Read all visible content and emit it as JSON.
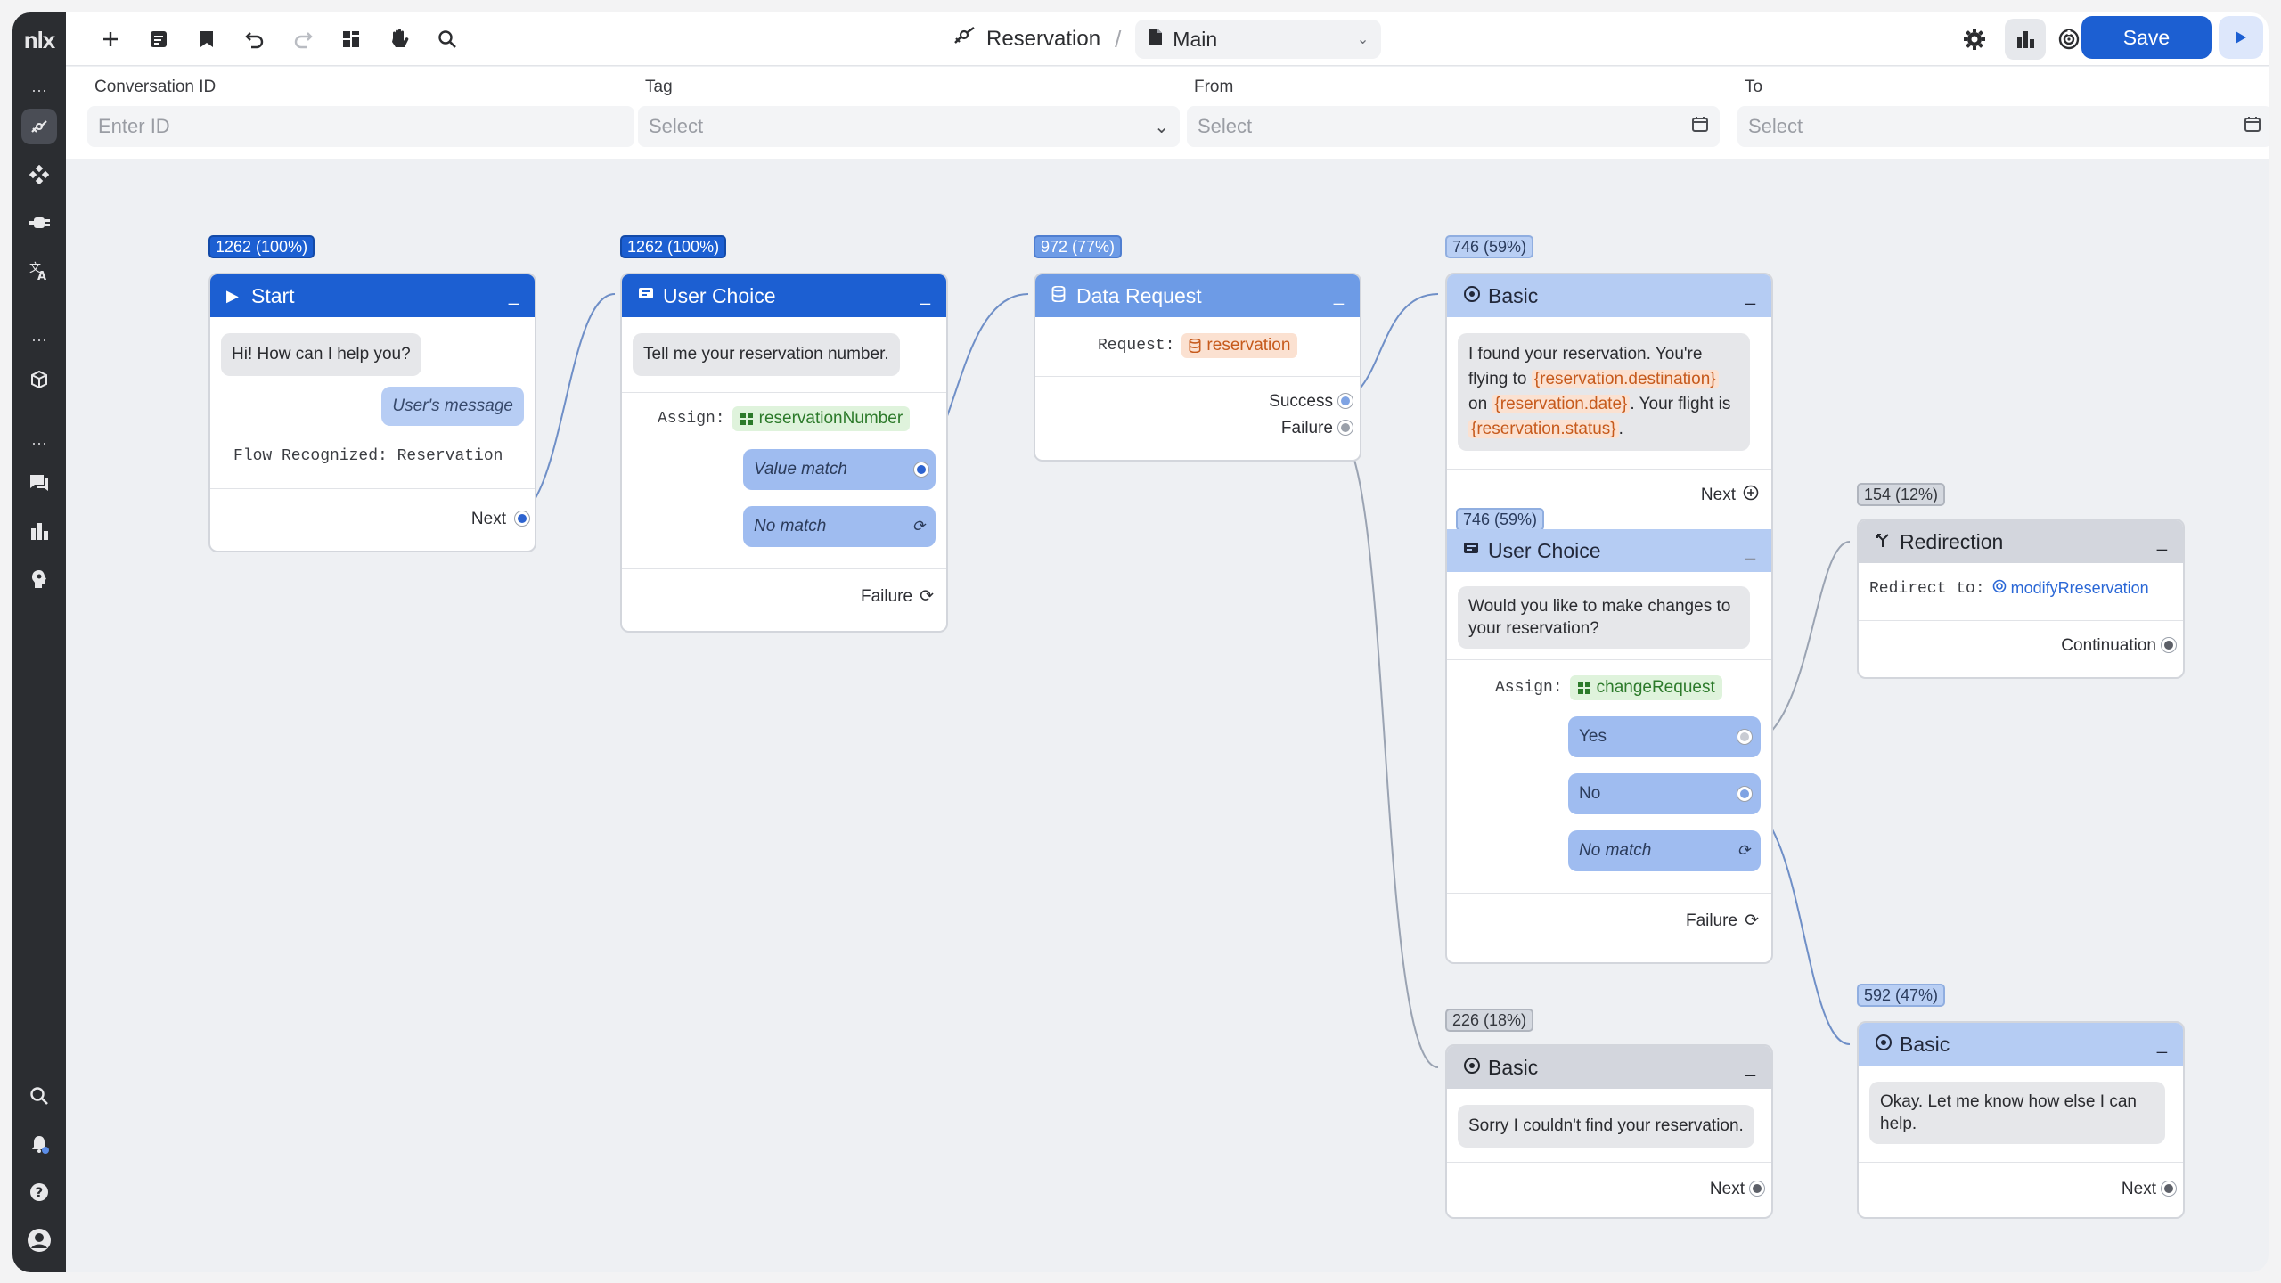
{
  "rail": {
    "logo": "nlx"
  },
  "breadcrumb": {
    "flow_icon": "flow-icon",
    "title": "Reservation",
    "separator": "/",
    "page": "Main"
  },
  "toolbar": {
    "save_label": "Save"
  },
  "filters": {
    "conversation_id": {
      "label": "Conversation ID",
      "placeholder": "Enter ID"
    },
    "tag": {
      "label": "Tag",
      "placeholder": "Select"
    },
    "from": {
      "label": "From",
      "placeholder": "Select"
    },
    "to": {
      "label": "To",
      "placeholder": "Select"
    }
  },
  "nodes": {
    "start": {
      "stat": "1262 (100%)",
      "title": "Start",
      "bot_message": "Hi! How can I help you?",
      "user_message": "User's message",
      "recognized": "Flow Recognized: Reservation",
      "next": "Next"
    },
    "user_choice_1": {
      "stat": "1262 (100%)",
      "title": "User Choice",
      "message": "Tell me your reservation number.",
      "assign_label": "Assign:",
      "assign_var": "reservationNumber",
      "choice_value_match": "Value match",
      "choice_no_match": "No match",
      "failure": "Failure"
    },
    "data_request": {
      "stat": "972 (77%)",
      "title": "Data Request",
      "request_label": "Request:",
      "request_var": "reservation",
      "success": "Success",
      "failure": "Failure"
    },
    "basic_found": {
      "stat": "746 (59%)",
      "title": "Basic",
      "msg_1": "I found your reservation. You're",
      "msg_2": "flying to",
      "var_destination": "{reservation.destination}",
      "msg_3": "on",
      "var_date": "{reservation.date}",
      "msg_4": ". Your flight is",
      "var_status": "{reservation.status}",
      "msg_5": ".",
      "next": "Next"
    },
    "user_choice_2": {
      "stat": "746 (59%)",
      "title": "User Choice",
      "message": "Would you like to make changes to your reservation?",
      "assign_label": "Assign:",
      "assign_var": "changeRequest",
      "choice_yes": "Yes",
      "choice_no": "No",
      "choice_no_match": "No match",
      "failure": "Failure"
    },
    "redirection": {
      "stat": "154 (12%)",
      "title": "Redirection",
      "redirect_label": "Redirect to:",
      "redirect_target": "modifyRreservation",
      "continuation": "Continuation"
    },
    "basic_not_found": {
      "stat": "226 (18%)",
      "title": "Basic",
      "message": "Sorry I couldn't find your reservation.",
      "next": "Next"
    },
    "basic_help": {
      "stat": "592 (47%)",
      "title": "Basic",
      "message": "Okay. Let me know how else I can help.",
      "next": "Next"
    }
  },
  "colors": {
    "primary": "#1c5fd2",
    "mid_blue": "#6d9be6",
    "light_blue": "#b5ccf3",
    "grey": "#d3d6dd",
    "var_orange": "#c65a1c",
    "assign_green": "#2c7a2a"
  }
}
